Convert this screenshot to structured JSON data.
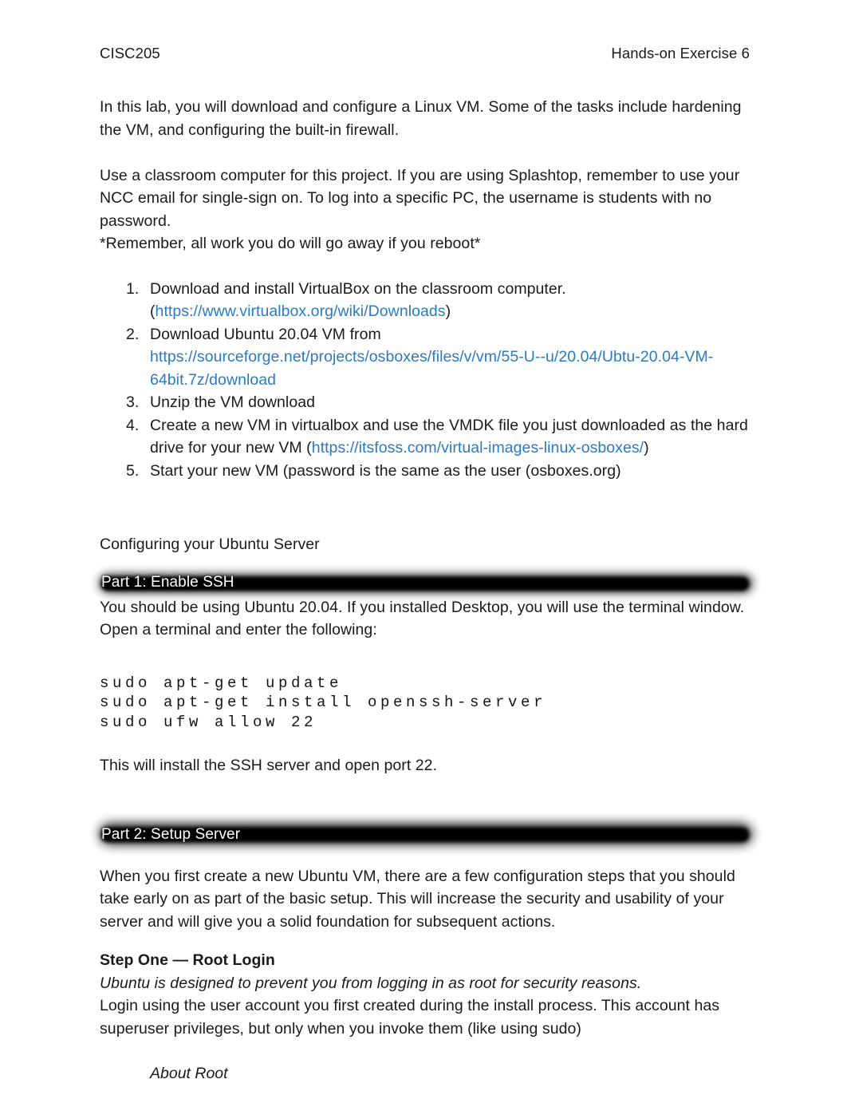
{
  "header": {
    "course_code": "CISC205",
    "exercise_title": "Hands-on Exercise 6"
  },
  "intro": {
    "paragraph_1": "In this lab, you will download and configure a Linux VM. Some of the tasks include hardening the VM, and configuring the built-in firewall.",
    "paragraph_2": "Use a classroom computer for this project. If you are using Splashtop, remember to use your NCC email for single-sign on. To log into a specific PC, the username is students with no password.",
    "reboot_note": "*Remember, all work you do will go away if you reboot*"
  },
  "steps": [
    {
      "text_before": "Download and install VirtualBox on the classroom computer. (",
      "link": "https://www.virtualbox.org/wiki/Downloads",
      "text_after": ")"
    },
    {
      "text_before": "Download Ubuntu 20.04 VM from ",
      "link": "https://sourceforge.net/projects/osboxes/files/v/vm/55-U--u/20.04/Ubtu-20.04-VM-64bit.7z/download",
      "text_after": ""
    },
    {
      "text_before": "Unzip the VM download",
      "link": "",
      "text_after": ""
    },
    {
      "text_before": "Create a new VM in virtualbox and use the VMDK file you just downloaded as the hard drive for your new VM (",
      "link": "https://itsfoss.com/virtual-images-linux-osboxes/",
      "text_after": ")"
    },
    {
      "text_before": "Start your new VM (password is the same as the user (osboxes.org)",
      "link": "",
      "text_after": ""
    }
  ],
  "section_intro": "Configuring your Ubuntu Server",
  "part1": {
    "banner_label": "Part 1: Enable SSH",
    "body": "You should be using Ubuntu 20.04. If you installed Desktop, you will use the terminal window. Open a terminal and enter the following:",
    "commands": "sudo apt-get update\nsudo apt-get install openssh-server\nsudo ufw allow 22",
    "after_commands": "This will install the SSH server and open port 22."
  },
  "part2": {
    "banner_label": "Part 2: Setup Server",
    "body": "When you first create a new Ubuntu VM, there are a few configuration steps that you should take early on as part of the basic setup. This will increase the security and usability of your server and will give you a solid foundation for subsequent actions.",
    "step_one_heading": "Step One — Root Login",
    "step_one_italic": "Ubuntu is designed to prevent you from logging in as root for security reasons.",
    "step_one_body": "Login using the user account you first created during the install process. This account has superuser privileges, but only when you invoke them (like using sudo)",
    "about_root": "About Root"
  },
  "colors": {
    "link": "#2a7ac4",
    "text": "#1a1a1a",
    "banner_background": "#000000",
    "banner_text": "#ffffff",
    "page_background": "#ffffff"
  }
}
